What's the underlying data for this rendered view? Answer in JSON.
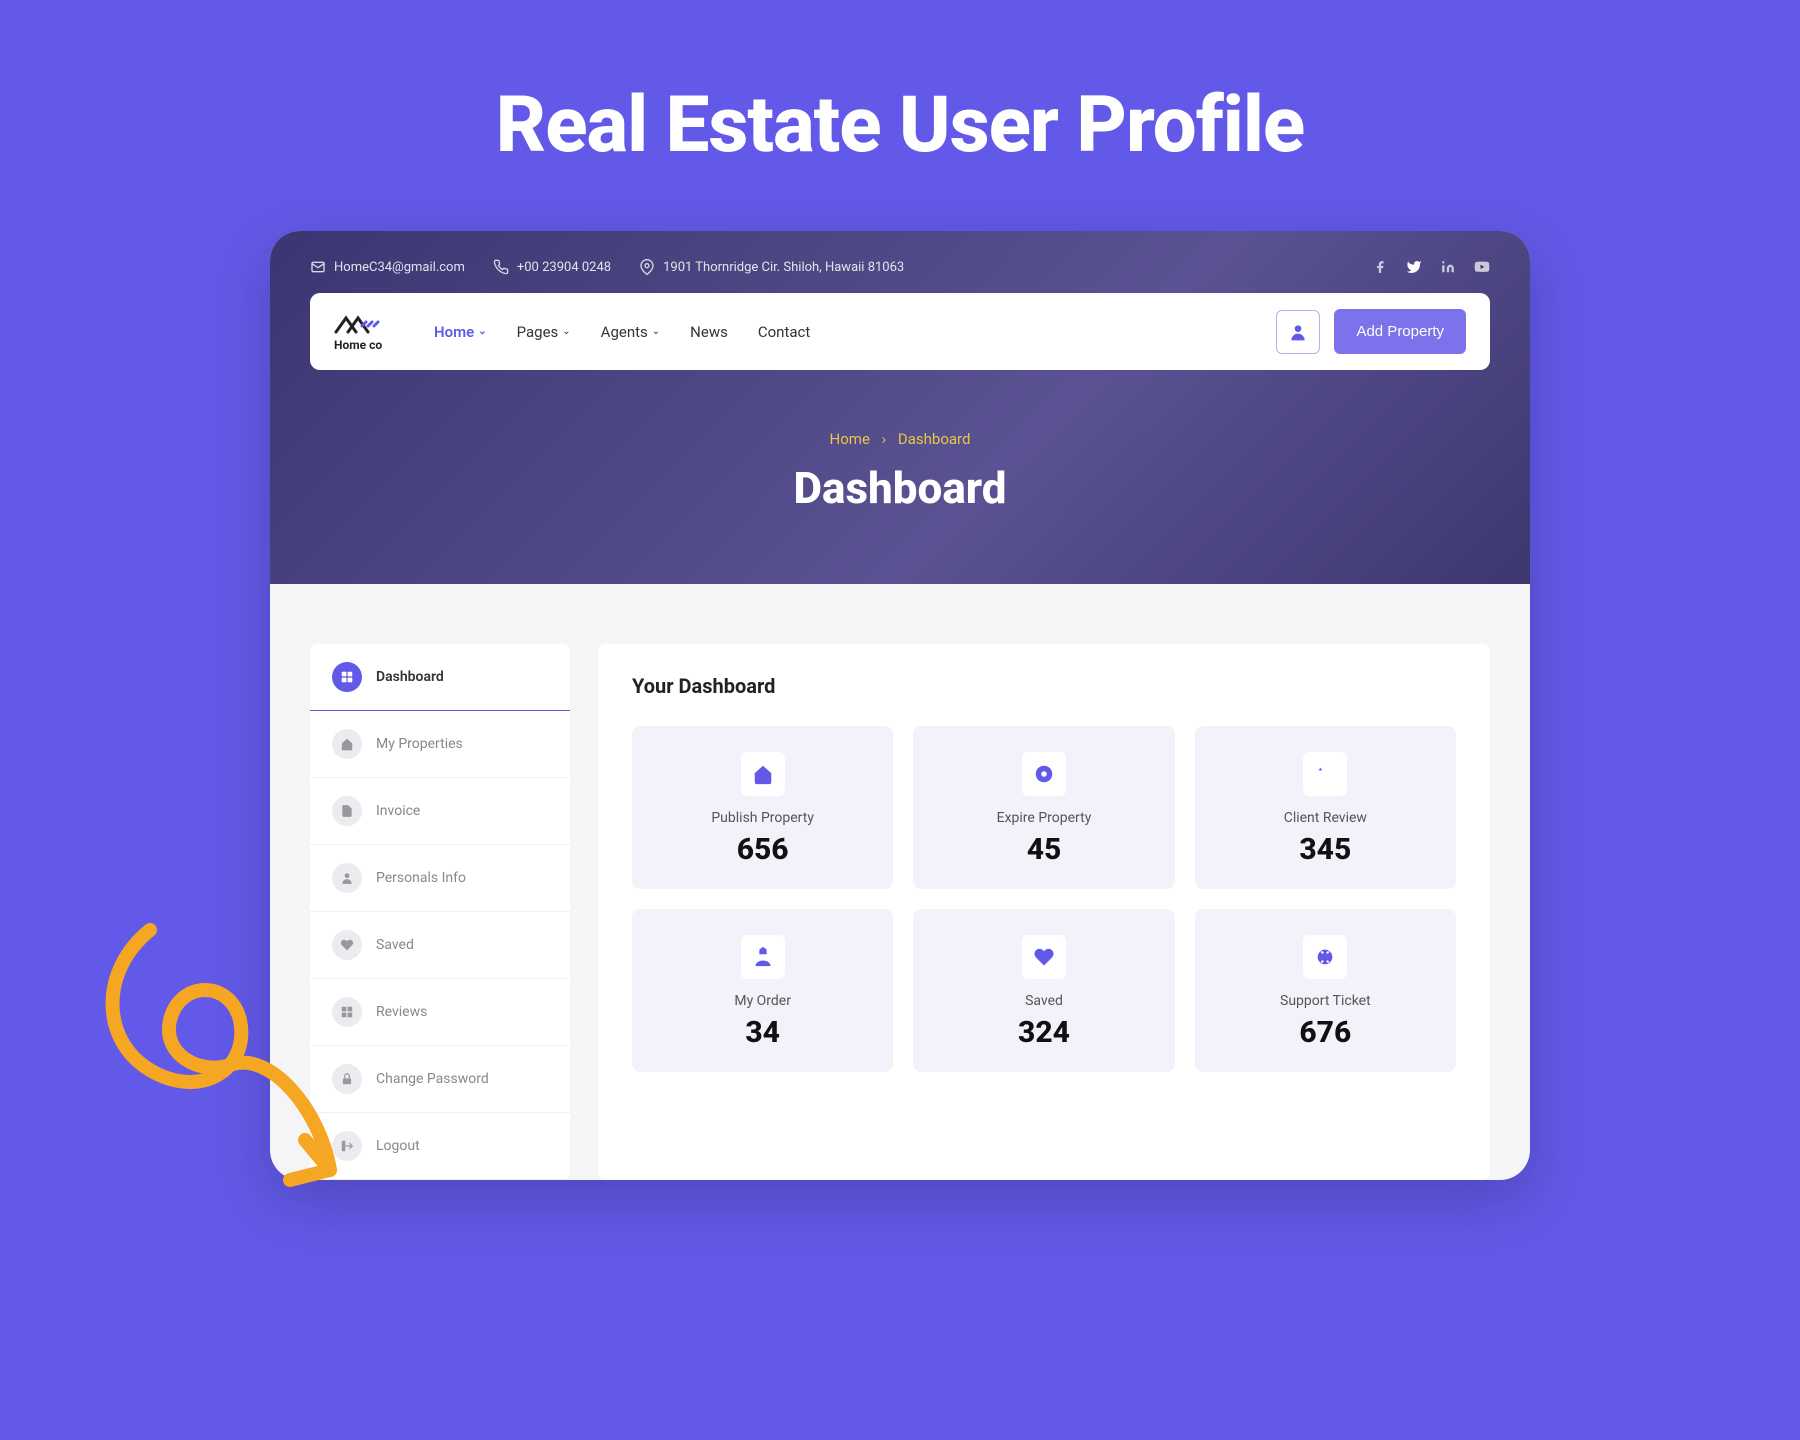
{
  "page_title": "Real Estate User Profile",
  "topbar": {
    "email": "HomeC34@gmail.com",
    "phone": "+00 23904 0248",
    "address": "1901 Thornridge Cir. Shiloh, Hawaii 81063"
  },
  "logo_text": "Home co",
  "nav": {
    "home": "Home",
    "pages": "Pages",
    "agents": "Agents",
    "news": "News",
    "contact": "Contact"
  },
  "add_property_label": "Add Property",
  "breadcrumb": {
    "home": "Home",
    "current": "Dashboard"
  },
  "hero_title": "Dashboard",
  "sidebar": {
    "items": [
      {
        "label": "Dashboard"
      },
      {
        "label": "My Properties"
      },
      {
        "label": "Invoice"
      },
      {
        "label": "Personals Info"
      },
      {
        "label": "Saved"
      },
      {
        "label": "Reviews"
      },
      {
        "label": "Change Password"
      },
      {
        "label": "Logout"
      }
    ]
  },
  "main": {
    "title": "Your Dashboard",
    "cards": [
      {
        "label": "Publish Property",
        "value": "656"
      },
      {
        "label": "Expire Property",
        "value": "45"
      },
      {
        "label": "Client Review",
        "value": "345"
      },
      {
        "label": "My Order",
        "value": "34"
      },
      {
        "label": "Saved",
        "value": "324"
      },
      {
        "label": "Support Ticket",
        "value": "676"
      }
    ]
  }
}
